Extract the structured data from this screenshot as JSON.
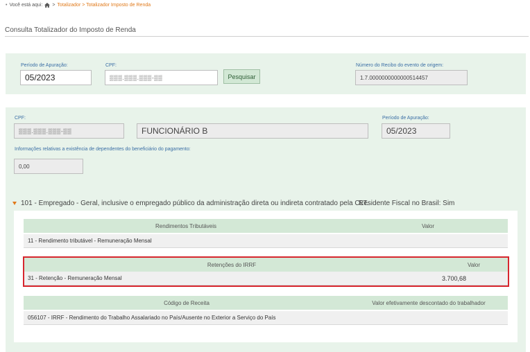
{
  "breadcrumb": {
    "prefix": "Você está aqui:",
    "separator": ">",
    "path": "Totalizador > Totalizador Imposto de Renda"
  },
  "page": {
    "title": "Consulta Totalizador do Imposto de Renda"
  },
  "search": {
    "periodo_label": "Período de Apuração:",
    "periodo_value": "05/2023",
    "cpf_label": "CPF:",
    "cpf_value": "▒▒▒.▒▒▒.▒▒▒-▒▒",
    "button_label": "Pesquisar",
    "recibo_label": "Número do Recibo do evento de origem:",
    "recibo_value": "1.7.0000000000000514457"
  },
  "result": {
    "cpf_label": "CPF:",
    "cpf_value": "▒▒▒.▒▒▒.▒▒▒-▒▒",
    "nome_value": "FUNCIONÁRIO B",
    "periodo_label": "Período de Apuração:",
    "periodo_value": "05/2023",
    "dependentes_label": "Informações relativas a existência de dependentes do beneficiário do pagamento:",
    "dependentes_value": "0,00"
  },
  "categoria": {
    "text": "101 - Empregado - Geral, inclusive o empregado público da administração direta ou indireta contratado pela CLT.",
    "residente": "Residente Fiscal no Brasil: Sim"
  },
  "rendimentos": {
    "col1": "Rendimentos Tributáveis",
    "col2": "Valor",
    "rows": [
      {
        "desc": "11 - Rendimento tributável - Remuneração Mensal",
        "valor": ""
      }
    ]
  },
  "retencoes": {
    "col1": "Retenções do IRRF",
    "col2": "Valor",
    "rows": [
      {
        "desc": "31 - Retenção - Remuneração Mensal",
        "valor": "3.700,68"
      }
    ]
  },
  "receita": {
    "col1": "Código de Receita",
    "col2": "Valor efetivamente descontado do trabalhador",
    "rows": [
      {
        "desc": "056107 - IRRF - Rendimento do Trabalho Assalariado no País/Ausente no Exterior a Serviço do País",
        "valor": ""
      }
    ]
  },
  "colors": {
    "panel": "#e8f3ea",
    "table_header": "#d3e8d6",
    "accent": "#e0791a",
    "highlight": "#d7262e"
  }
}
